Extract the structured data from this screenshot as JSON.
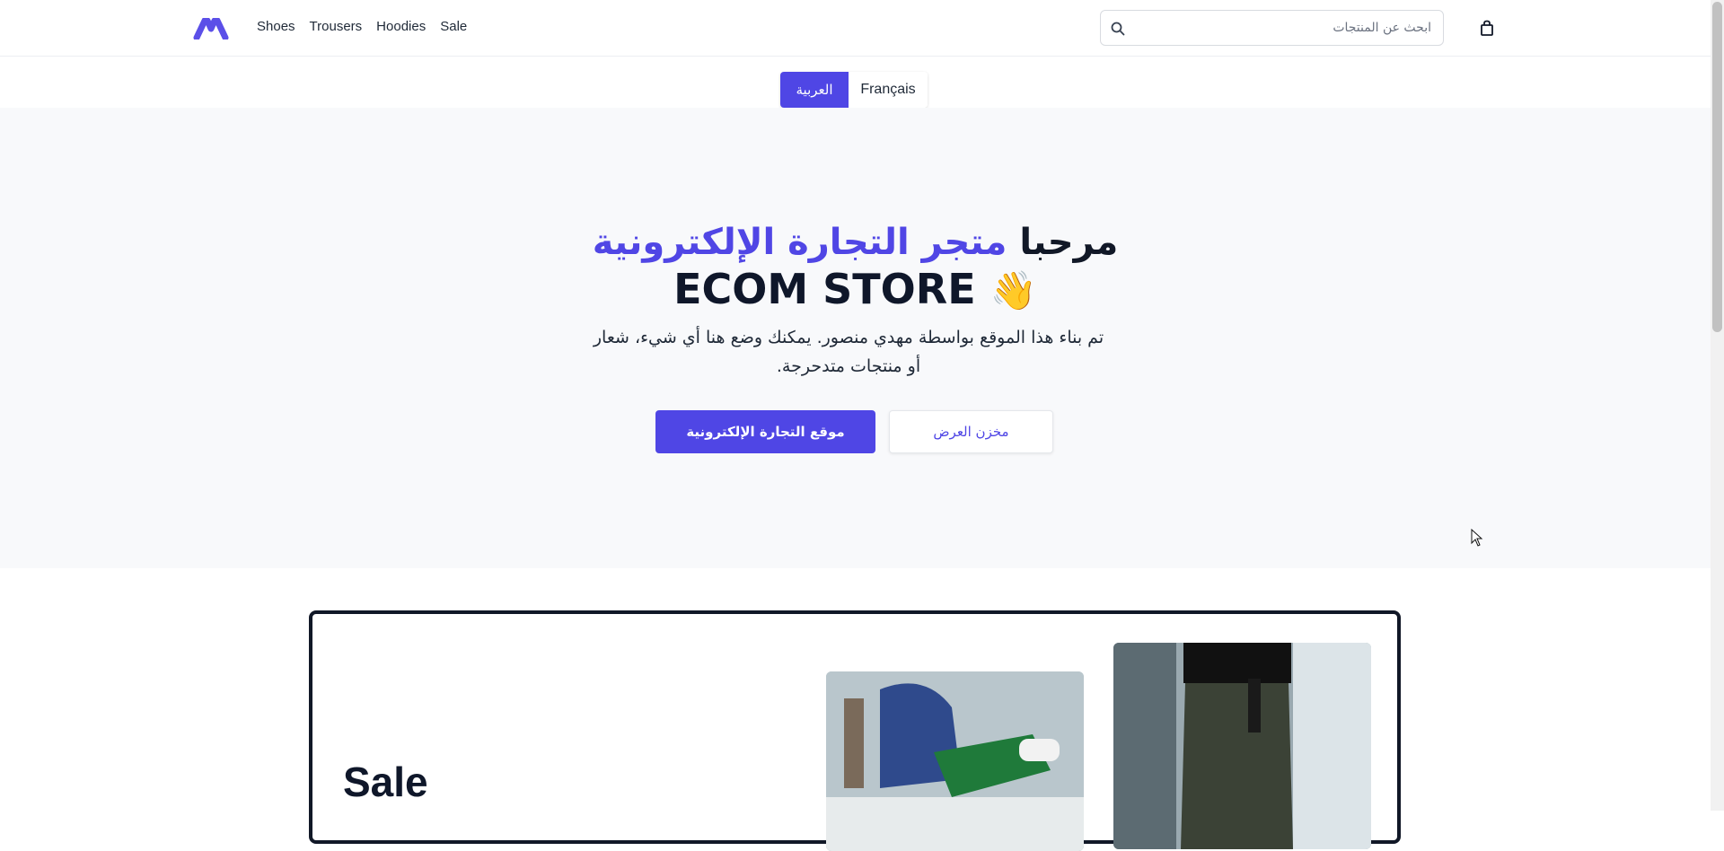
{
  "header": {
    "nav": [
      "Shoes",
      "Trousers",
      "Hoodies",
      "Sale"
    ],
    "search_placeholder": "ابحث عن المنتجات",
    "icons": [
      "logo-icon",
      "search-icon",
      "shopping-bag-icon"
    ]
  },
  "lang": {
    "active": "العربية",
    "inactive": "Français"
  },
  "hero": {
    "title_plain": "مرحبا",
    "title_accent": "متجر التجارة الإلكترونية",
    "title_line2": "ECOM STORE",
    "wave_emoji": "👋",
    "subtitle": "تم بناء هذا الموقع بواسطة مهدي منصور. يمكنك وضع هنا أي شيء، شعار أو منتجات متدحرجة.",
    "primary_button": "موقع التجارة الإلكترونية",
    "secondary_button": "مخزن العرض"
  },
  "sale": {
    "title": "Sale"
  },
  "colors": {
    "accent": "#4f46e5",
    "hero_bg": "#f8f9fb"
  }
}
